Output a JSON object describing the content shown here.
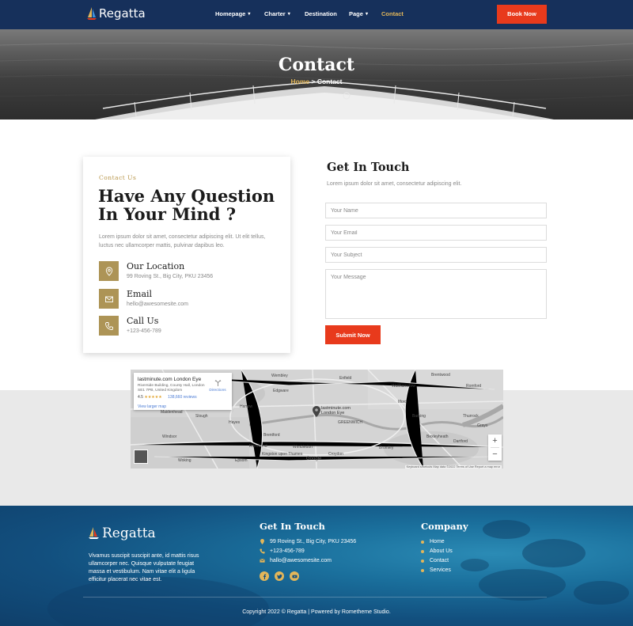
{
  "brand": {
    "name": "Regatta"
  },
  "nav": {
    "items": [
      {
        "label": "Homepage",
        "has_dropdown": true
      },
      {
        "label": "Charter",
        "has_dropdown": true
      },
      {
        "label": "Destination",
        "has_dropdown": false
      },
      {
        "label": "Page",
        "has_dropdown": true
      },
      {
        "label": "Contact",
        "has_dropdown": false,
        "active": true
      }
    ],
    "cta_label": "Book Now"
  },
  "hero": {
    "title": "Contact",
    "breadcrumb": {
      "home": "Home",
      "separator": ">",
      "current": "Contact"
    }
  },
  "contact_card": {
    "kicker": "Contact Us",
    "title_line1": "Have Any Question",
    "title_line2": "In Your Mind ?",
    "description": "Lorem ipsum dolor sit amet, consectetur adipiscing elit. Ut elit tellus, luctus nec ullamcorper mattis, pulvinar dapibus leo.",
    "items": [
      {
        "icon": "location-pin-icon",
        "label": "Our Location",
        "value": "99 Roving St., Big City, PKU 23456"
      },
      {
        "icon": "envelope-icon",
        "label": "Email",
        "value": "hello@awesomesite.com"
      },
      {
        "icon": "phone-icon",
        "label": "Call Us",
        "value": "+123-456-789"
      }
    ]
  },
  "form": {
    "title": "Get In Touch",
    "subtitle": "Lorem ipsum dolor sit amet, consectetur adipiscing elit.",
    "name_placeholder": "Your Name",
    "email_placeholder": "Your Email",
    "subject_placeholder": "Your Subject",
    "message_placeholder": "Your Message",
    "submit_label": "Submit Now"
  },
  "map": {
    "place_title": "lastminute.com London Eye",
    "place_address": "Riverside Building, County Hall, London SE1 7PB, United Kingdom",
    "rating": "4.5",
    "stars": "★★★★★",
    "reviews": "138,660 reviews",
    "larger_map_label": "View larger map",
    "directions_label": "Directions",
    "pin_label_line1": "lastminute.com",
    "pin_label_line2": "London Eye",
    "zoom_in": "+",
    "zoom_out": "−",
    "google_label": "Google",
    "attribution": "Keyboard shortcuts   Map data ©2022   Terms of Use   Report a map error",
    "places": [
      {
        "name": "Wembley"
      },
      {
        "name": "Edgware"
      },
      {
        "name": "Enfield"
      },
      {
        "name": "Walthamstow"
      },
      {
        "name": "Brentwood"
      },
      {
        "name": "Romford"
      },
      {
        "name": "Harrow"
      },
      {
        "name": "Ilford"
      },
      {
        "name": "Barking"
      },
      {
        "name": "Slough"
      },
      {
        "name": "Maidenhead"
      },
      {
        "name": "Hayes"
      },
      {
        "name": "Brentford"
      },
      {
        "name": "Richmond"
      },
      {
        "name": "Wimbledon"
      },
      {
        "name": "Kingston upon Thames"
      },
      {
        "name": "Croydon"
      },
      {
        "name": "Bromley"
      },
      {
        "name": "Dartford"
      },
      {
        "name": "Bexleyheath"
      },
      {
        "name": "Grays"
      },
      {
        "name": "Windsor"
      },
      {
        "name": "Woking"
      },
      {
        "name": "Epsom"
      },
      {
        "name": "GREENWICH"
      },
      {
        "name": "Thurrock"
      }
    ]
  },
  "footer": {
    "brand": "Regatta",
    "description": "Vivamus suscipit suscipit ante, id mattis risus ullamcorper nec. Quisque vulputate feugiat massa et vestibulum. Nam vitae elit a ligula efficitur placerat nec vitae est.",
    "contact_heading": "Get In Touch",
    "address": "99 Roving St., Big City, PKU 23456",
    "phone": "+123-456-789",
    "email": "hallo@awesomesite.com",
    "company_heading": "Company",
    "company_links": [
      "Home",
      "About Us",
      "Contact",
      "Services"
    ],
    "socials": [
      "facebook-icon",
      "twitter-icon",
      "youtube-icon"
    ],
    "copyright": "Copyright 2022 © Regatta | Powered by Rometheme Studio."
  },
  "colors": {
    "nav_bg": "#16305b",
    "accent_red": "#e83a1c",
    "gold": "#ad9456",
    "active_link": "#e2b65a"
  }
}
